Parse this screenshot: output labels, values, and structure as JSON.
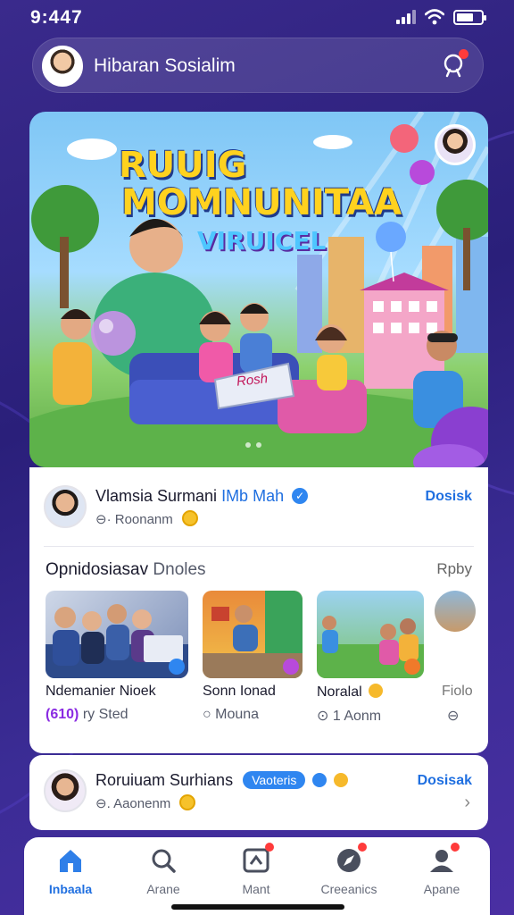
{
  "status": {
    "time": "9:447"
  },
  "header": {
    "title": "Hibaran Sosialim"
  },
  "hero": {
    "title_line1": "RUUIG",
    "title_line2": "MOMNUNITAA",
    "subtitle": "VIRUICEL",
    "laptop_text": "Rosh"
  },
  "post": {
    "user_name": "Vlamsia Surmani",
    "user_name_highlight": "IMb Mah",
    "meta": "⊖· Roonanm",
    "action": "Dosisk"
  },
  "section": {
    "title": "Opnidosiasav",
    "title_muted": "Dnoles",
    "more": "Rpby"
  },
  "thumbs": [
    {
      "label": "Ndemanier Nioek",
      "sub_highlight": "(610)",
      "sub": "ry Sted"
    },
    {
      "label": "Sonn Ionad",
      "sub": "○ Mouna"
    },
    {
      "label": "Noralal",
      "sub": "⊙ 1 Aonm"
    },
    {
      "label": "Fiolo",
      "sub": "⊖"
    }
  ],
  "post2": {
    "user_name": "Roruiuam Surhians",
    "tag": "Vaoteris",
    "meta": "⊖. Aaonenm",
    "action": "Dosisak"
  },
  "tabs": [
    {
      "label": "Inbaala",
      "icon": "home-icon",
      "active": true
    },
    {
      "label": "Arane",
      "icon": "search-icon"
    },
    {
      "label": "Mant",
      "icon": "create-icon"
    },
    {
      "label": "Creeanics",
      "icon": "compass-icon"
    },
    {
      "label": "Apane",
      "icon": "profile-icon"
    }
  ],
  "colors": {
    "accent": "#1f6fe0",
    "background": "#2a1f7a",
    "notification": "#ff3b3b"
  }
}
